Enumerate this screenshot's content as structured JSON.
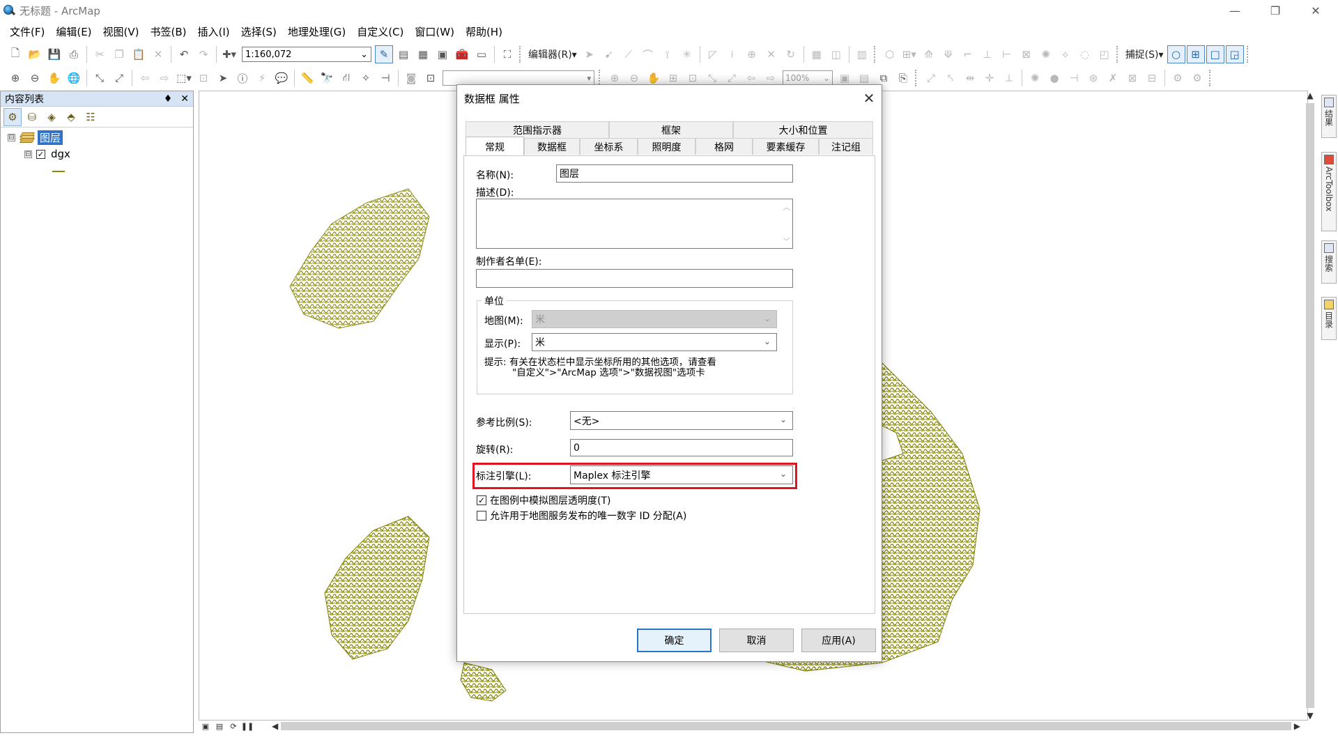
{
  "window": {
    "title": "无标题 - ArcMap",
    "controls": {
      "minimize": "—",
      "restore": "❐",
      "close": "✕"
    }
  },
  "menubar": [
    "文件(F)",
    "编辑(E)",
    "视图(V)",
    "书签(B)",
    "插入(I)",
    "选择(S)",
    "地理处理(G)",
    "自定义(C)",
    "窗口(W)",
    "帮助(H)"
  ],
  "toolbar": {
    "scale": "1:160,072",
    "editor_label": "编辑器(R)▾",
    "snapping_label": "捕捉(S)▾",
    "zoom_percent": "100%"
  },
  "toc": {
    "title": "内容列表",
    "pin": "♦",
    "close": "✕",
    "root_label": "图层",
    "layer_label": "dgx",
    "expander_symbol": "⊟",
    "check_symbol": "✓",
    "legend_color": "#8a8a00"
  },
  "map": {
    "contour_color": "#7f7f00",
    "view_buttons": [
      "▣",
      "▤",
      "⟳",
      "❚❚"
    ]
  },
  "right_dock": [
    "结果",
    "ArcToolbox",
    "搜索",
    "目录"
  ],
  "dialog": {
    "title": "数据框 属性",
    "close": "✕",
    "tabs_top": [
      "范围指示器",
      "框架",
      "大小和位置"
    ],
    "tabs_bottom": [
      "常规",
      "数据框",
      "坐标系",
      "照明度",
      "格网",
      "要素缓存",
      "注记组"
    ],
    "name_label": "名称(N):",
    "name_value": "图层",
    "description_label": "描述(D):",
    "credits_label": "制作者名单(E):",
    "units_group": "单位",
    "map_units_label": "地图(M):",
    "map_units_value": "米",
    "display_units_label": "显示(P):",
    "display_units_value": "米",
    "hint_line1": "提示:  有关在状态栏中显示坐标所用的其他选项，请查看",
    "hint_line2": "\"自定义\">\"ArcMap 选项\">\"数据视图\"选项卡",
    "ref_scale_label": "参考比例(S):",
    "ref_scale_value": "<无>",
    "rotation_label": "旋转(R):",
    "rotation_value": "0",
    "label_engine_label": "标注引擎(L):",
    "label_engine_value": "Maplex 标注引擎",
    "highlight_color": "#e0141e",
    "checkbox1_label": "在图例中模拟图层透明度(T)",
    "checkbox1_checked": true,
    "checkbox2_label": "允许用于地图服务发布的唯一数字 ID 分配(A)",
    "checkbox2_checked": false,
    "ok_label": "确定",
    "cancel_label": "取消",
    "apply_label": "应用(A)"
  }
}
